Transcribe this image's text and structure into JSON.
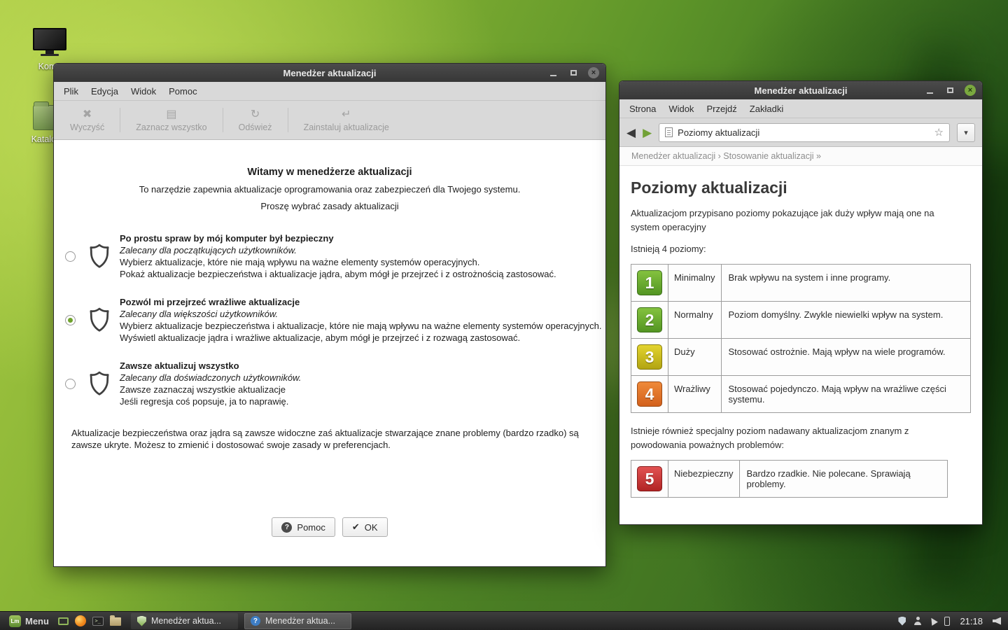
{
  "icons": {
    "clear": "✖",
    "select_all": "▤",
    "refresh": "↻",
    "install": "↵",
    "close": "×",
    "help_q": "?",
    "ok_check": "✔",
    "back": "◀",
    "forward": "▶",
    "star": "☆",
    "dropdown": "▾",
    "terminal_prompt": ">_",
    "mint_logo": "Lm"
  },
  "colors": {
    "accent_green": "#6fa22d",
    "titlebar": "#3a3a3a",
    "toolbar_bg": "#d9d9d9",
    "level_green": "#539522",
    "level_yellow": "#b2a412",
    "level_orange": "#d2601c",
    "level_red": "#b12424"
  },
  "desktop": {
    "icons": [
      {
        "label": "Komp"
      },
      {
        "label": "Katalog d"
      }
    ]
  },
  "wizard_window": {
    "title": "Menedżer aktualizacji",
    "menu": [
      "Plik",
      "Edycja",
      "Widok",
      "Pomoc"
    ],
    "toolbar": [
      {
        "label": "Wyczyść"
      },
      {
        "label": "Zaznacz wszystko"
      },
      {
        "label": "Odśwież"
      },
      {
        "label": "Zainstaluj aktualizacje"
      }
    ],
    "welcome_title": "Witamy w menedżerze aktualizacji",
    "welcome_subtitle": "To narzędzie zapewnia aktualizacje oprogramowania oraz zabezpieczeń dla Twojego systemu.",
    "welcome_prompt": "Proszę wybrać zasady aktualizacji",
    "options": [
      {
        "title": "Po prostu spraw by mój komputer był bezpieczny",
        "subtitle": "Zalecany dla początkujących użytkowników.",
        "line1": "Wybierz aktualizacje, które nie mają wpływu na ważne elementy systemów operacyjnych.",
        "line2": "Pokaż aktualizacje bezpieczeństwa i aktualizacje jądra, abym mógł je przejrzeć i z ostrożnością zastosować.",
        "selected": false
      },
      {
        "title": "Pozwól mi przejrzeć wrażliwe aktualizacje",
        "subtitle": "Zalecany dla większości użytkowników.",
        "line1": "Wybierz aktualizacje bezpieczeństwa i aktualizacje, które nie mają wpływu na ważne elementy systemów operacyjnych.",
        "line2": "Wyświetl aktualizacje jądra i wrażliwe aktualizacje, abym mógł je przejrzeć i z rozwagą zastosować.",
        "selected": true
      },
      {
        "title": "Zawsze aktualizuj wszystko",
        "subtitle": "Zalecany dla doświadczonych użytkowników.",
        "line1": "Zawsze zaznaczaj wszystkie aktualizacje",
        "line2": "Jeśli regresja coś popsuje, ja to naprawię.",
        "selected": false
      }
    ],
    "footnote": "Aktualizacje bezpieczeństwa oraz jądra są zawsze widoczne zaś aktualizacje stwarzające znane problemy (bardzo rzadko) są zawsze ukryte. Możesz to zmienić i dostosować swoje zasady w preferencjach.",
    "help_button": "Pomoc",
    "ok_button": "OK"
  },
  "help_window": {
    "title": "Menedżer aktualizacji",
    "menu": [
      "Strona",
      "Widok",
      "Przejdź",
      "Zakładki"
    ],
    "address": "Poziomy aktualizacji",
    "breadcrumb": "Menedżer aktualizacji › Stosowanie aktualizacji »",
    "heading": "Poziomy aktualizacji",
    "intro": "Aktualizacjom przypisano poziomy pokazujące jak duży wpływ mają one na system operacyjny",
    "levels_label": "Istnieją 4 poziomy:",
    "levels": [
      {
        "number": "1",
        "name": "Minimalny",
        "description": "Brak wpływu na system i inne programy.",
        "color": "#539522"
      },
      {
        "number": "2",
        "name": "Normalny",
        "description": "Poziom domyślny. Zwykle niewielki wpływ na system.",
        "color": "#539522"
      },
      {
        "number": "3",
        "name": "Duży",
        "description": "Stosować ostrożnie. Mają wpływ na wiele programów.",
        "color": "#b2a412"
      },
      {
        "number": "4",
        "name": "Wrażliwy",
        "description": "Stosować pojedynczo. Mają wpływ na wrażliwe części systemu.",
        "color": "#d2601c"
      }
    ],
    "special_label": "Istnieje również specjalny poziom nadawany aktualizacjom znanym z powodowania poważnych problemów:",
    "special_level": {
      "number": "5",
      "name": "Niebezpieczny",
      "description": "Bardzo rzadkie. Nie polecane. Sprawiają problemy.",
      "color": "#b12424"
    }
  },
  "taskbar": {
    "menu_label": "Menu",
    "window_buttons": [
      {
        "label": "Menedżer aktua...",
        "active": false
      },
      {
        "label": "Menedżer aktua...",
        "active": true
      }
    ],
    "clock": "21:18"
  }
}
